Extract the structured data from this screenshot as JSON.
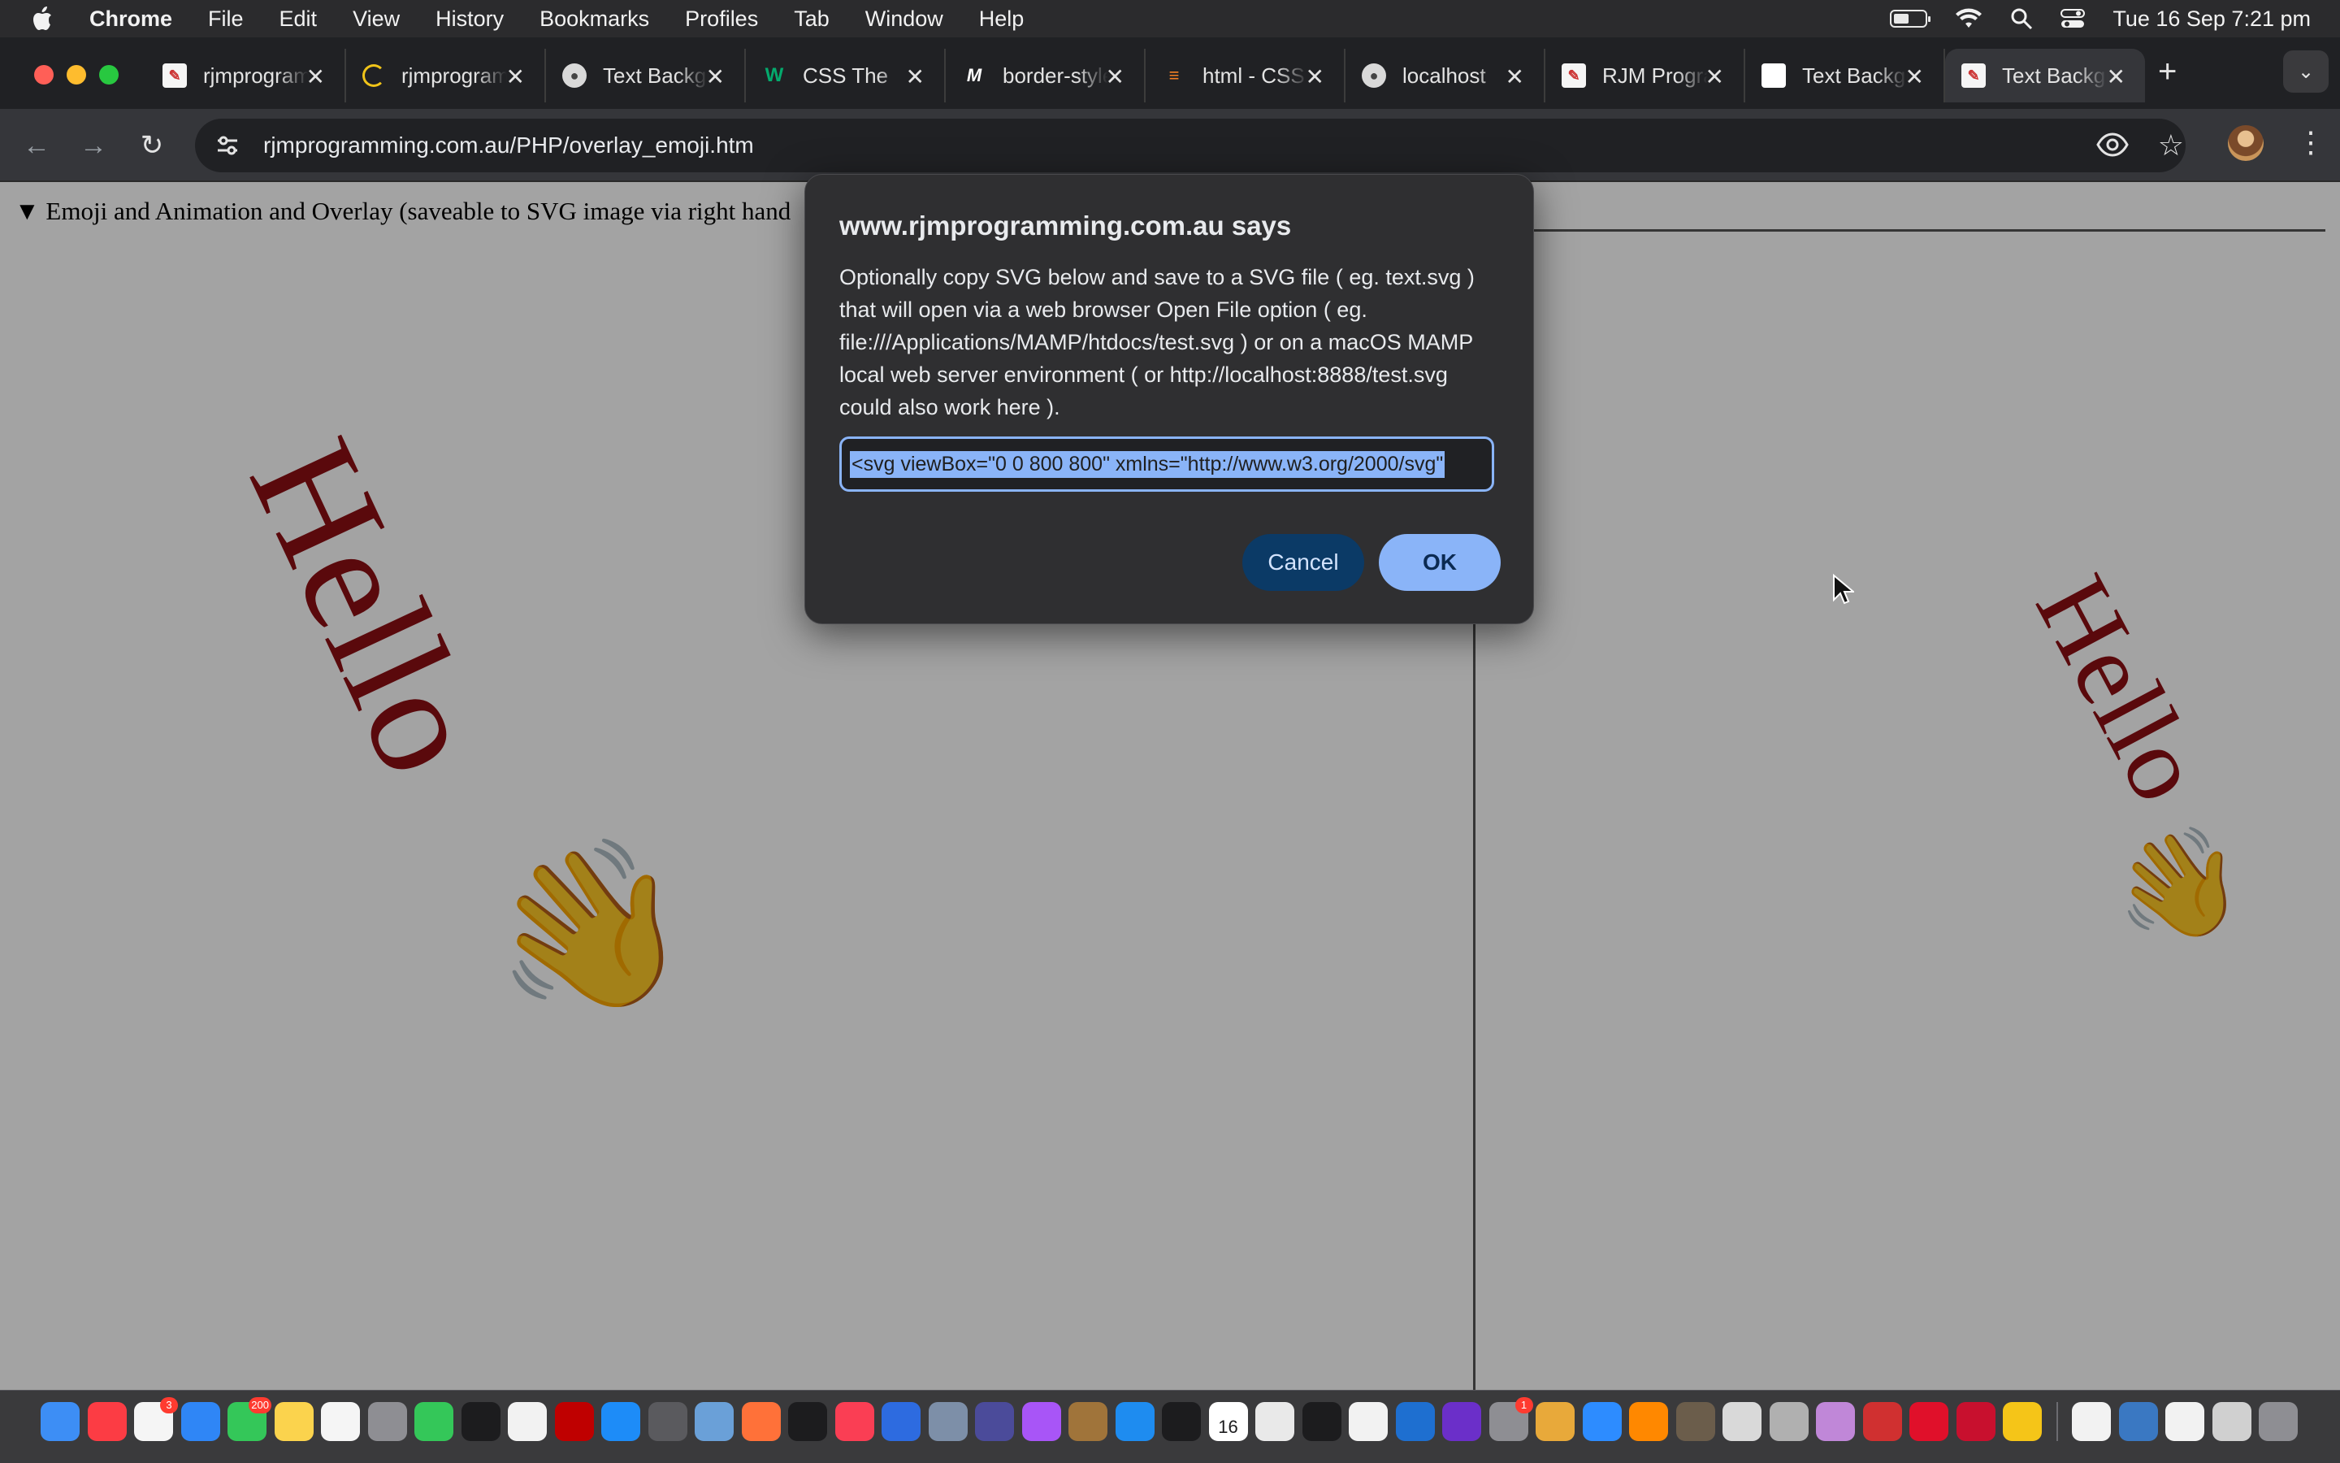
{
  "menubar": {
    "app_name": "Chrome",
    "items": [
      "File",
      "Edit",
      "View",
      "History",
      "Bookmarks",
      "Profiles",
      "Tab",
      "Window",
      "Help"
    ],
    "datetime": "Tue 16 Sep  7:21 pm"
  },
  "tabs": [
    {
      "label": "rjmprogramming",
      "favicon": "rjm-favicon",
      "active": false
    },
    {
      "label": "rjmprogramming",
      "favicon": "loading-spinner",
      "active": false
    },
    {
      "label": "Text Background",
      "favicon": "elephant-favicon",
      "active": false
    },
    {
      "label": "CSS The",
      "favicon": "w3schools-favicon",
      "active": false
    },
    {
      "label": "border-style",
      "favicon": "mdn-favicon",
      "active": false
    },
    {
      "label": "html - CSS",
      "favicon": "stackoverflow-favicon",
      "active": false
    },
    {
      "label": "localhost",
      "favicon": "elephant-favicon",
      "active": false
    },
    {
      "label": "RJM Programming",
      "favicon": "rjm-favicon",
      "active": false
    },
    {
      "label": "Text Background",
      "favicon": "blank-page-favicon",
      "active": false
    },
    {
      "label": "Text Background",
      "favicon": "rjm-favicon",
      "active": true
    }
  ],
  "toolbar": {
    "url": "rjmprogramming.com.au/PHP/overlay_emoji.htm"
  },
  "page": {
    "summary": "▼ Emoji and Animation and Overlay (saveable to SVG image via right hand",
    "hello_left": "Hello",
    "hello_right": "Hello",
    "emoji": "👋"
  },
  "dialog": {
    "title": "www.rjmprogramming.com.au says",
    "message": "Optionally copy SVG below and save to a SVG file ( eg. text.svg ) that will open via a web browser Open File option ( eg. file:///Applications/MAMP/htdocs/test.svg ) or on a macOS MAMP local web server environment ( or http://localhost:8888/test.svg could also work here ).",
    "input_value": "<svg viewBox=\"0 0 800 800\" xmlns=\"http://www.w3.org/2000/svg\"",
    "cancel_label": "Cancel",
    "ok_label": "OK"
  },
  "dock": {
    "icons": [
      "finder",
      "music",
      "reminders",
      "mail",
      "messages",
      "notes",
      "freeform",
      "launchpad",
      "facetime",
      "terminal",
      "textedit",
      "filezilla",
      "app-store",
      "calculator",
      "preview",
      "firefox",
      "apple-tv",
      "news",
      "safari-tp",
      "system-info",
      "bbedit",
      "podcasts",
      "archive-utility",
      "safari",
      "terminal-2",
      "calendar",
      "chrome",
      "activity-monitor",
      "textedit-2",
      "quicktime",
      "intellij",
      "system-settings",
      "color-picker",
      "zoom",
      "vlc",
      "gimp",
      "elephant",
      "pencil",
      "cat",
      "compass",
      "opera",
      "filezilla-pro",
      "bulb",
      "downloads",
      "screenshots",
      "preview-2",
      "mail-2",
      "trash"
    ],
    "badges": {
      "reminders": "3",
      "messages": "200",
      "system-settings": "1"
    },
    "calendar_date": "16"
  }
}
